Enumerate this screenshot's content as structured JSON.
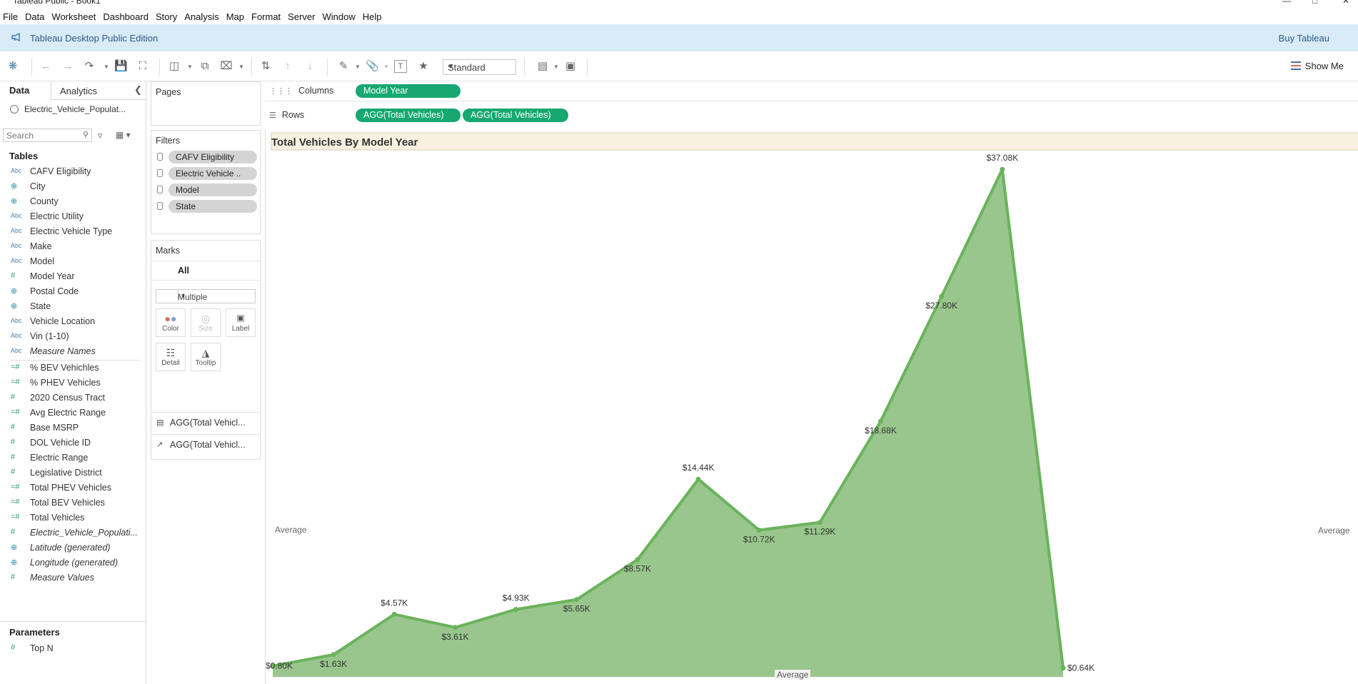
{
  "window": {
    "title": "Tableau Public - Book1"
  },
  "menu": [
    "File",
    "Data",
    "Worksheet",
    "Dashboard",
    "Story",
    "Analysis",
    "Map",
    "Format",
    "Server",
    "Window",
    "Help"
  ],
  "banner": {
    "edition": "Tableau Desktop Public Edition",
    "buy": "Buy Tableau"
  },
  "toolbar": {
    "fit": "Standard",
    "show_me": "Show Me"
  },
  "data_pane": {
    "tab_data": "Data",
    "tab_analytics": "Analytics",
    "datasource": "Electric_Vehicle_Populat...",
    "search_placeholder": "Search",
    "tables_heading": "Tables",
    "dimensions": [
      {
        "icon": "Abc",
        "label": "CAFV Eligibility"
      },
      {
        "icon": "globe",
        "label": "City"
      },
      {
        "icon": "globe",
        "label": "County"
      },
      {
        "icon": "Abc",
        "label": "Electric Utility"
      },
      {
        "icon": "Abc",
        "label": "Electric Vehicle Type"
      },
      {
        "icon": "Abc",
        "label": "Make"
      },
      {
        "icon": "Abc",
        "label": "Model"
      },
      {
        "icon": "#",
        "label": "Model Year"
      },
      {
        "icon": "globe",
        "label": "Postal Code"
      },
      {
        "icon": "globe",
        "label": "State"
      },
      {
        "icon": "Abc",
        "label": "Vehicle Location"
      },
      {
        "icon": "Abc",
        "label": "Vin (1-10)"
      },
      {
        "icon": "Abc",
        "label": "Measure Names",
        "italic": true
      }
    ],
    "measures": [
      {
        "icon": "=#",
        "label": "% BEV Vehichles"
      },
      {
        "icon": "=#",
        "label": "% PHEV Vehicles"
      },
      {
        "icon": "#",
        "label": "2020 Census Tract"
      },
      {
        "icon": "=#",
        "label": "Avg Electric Range"
      },
      {
        "icon": "#",
        "label": "Base MSRP"
      },
      {
        "icon": "#",
        "label": "DOL Vehicle ID"
      },
      {
        "icon": "#",
        "label": "Electric Range"
      },
      {
        "icon": "#",
        "label": "Legislative District"
      },
      {
        "icon": "=#",
        "label": "Total  PHEV Vehicles"
      },
      {
        "icon": "=#",
        "label": "Total BEV Vehicles"
      },
      {
        "icon": "=#",
        "label": "Total Vehicles"
      },
      {
        "icon": "#",
        "label": "Electric_Vehicle_Populati...",
        "italic": true
      },
      {
        "icon": "globe",
        "label": "Latitude (generated)",
        "italic": true
      },
      {
        "icon": "globe",
        "label": "Longitude (generated)",
        "italic": true
      },
      {
        "icon": "#",
        "label": "Measure Values",
        "italic": true
      }
    ],
    "parameters_heading": "Parameters",
    "parameters": [
      {
        "icon": "#",
        "label": "Top N"
      }
    ]
  },
  "pages": {
    "label": "Pages"
  },
  "filters": {
    "label": "Filters",
    "items": [
      "CAFV Eligibility",
      "Electric Vehicle ..",
      "Model",
      "State"
    ]
  },
  "marks": {
    "label": "Marks",
    "all": "All",
    "type": "Multiple",
    "buttons": [
      "Color",
      "Size",
      "Label",
      "Detail",
      "Tooltip"
    ],
    "cards": [
      "AGG(Total Vehicl...",
      "AGG(Total Vehicl..."
    ]
  },
  "shelves": {
    "columns_label": "Columns",
    "rows_label": "Rows",
    "columns": [
      "Model Year"
    ],
    "rows": [
      "AGG(Total Vehicles)",
      "AGG(Total Vehicles)"
    ]
  },
  "viz": {
    "title": "Total Vehicles By Model Year",
    "ref_label_left": "Average",
    "ref_label_right": "Average",
    "ref_label_bottom": "Average",
    "area_color": "#98c68c",
    "line_color": "#6ab35c"
  },
  "chart_data": {
    "type": "area",
    "title": "Total Vehicles By Model Year",
    "xlabel": "",
    "ylabel": "",
    "y_unit": "thousands",
    "values": [
      0.8,
      1.63,
      4.57,
      3.61,
      4.93,
      5.65,
      8.57,
      14.44,
      10.72,
      11.29,
      18.68,
      27.8,
      37.08,
      0.64
    ],
    "labels": [
      "$0.80K",
      "$1.63K",
      "$4.57K",
      "$3.61K",
      "$4.93K",
      "$5.65K",
      "$8.57K",
      "$14.44K",
      "$10.72K",
      "$11.29K",
      "$18.68K",
      "$27.80K",
      "$37.08K",
      "$0.64K"
    ],
    "label_position": [
      "right",
      "below",
      "above",
      "below",
      "above",
      "below",
      "below",
      "above",
      "below",
      "below",
      "below",
      "below",
      "above",
      "right"
    ],
    "ylim": [
      0,
      38.5
    ],
    "grid": false
  }
}
